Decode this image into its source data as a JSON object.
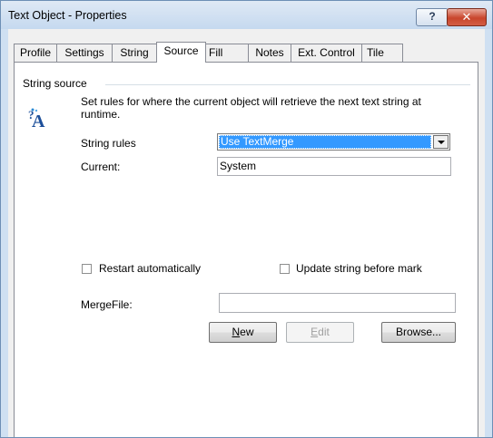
{
  "window": {
    "title": "Text Object - Properties",
    "help_label": "?",
    "close_label": "✕"
  },
  "tabs": [
    {
      "label": "Profile"
    },
    {
      "label": "Settings"
    },
    {
      "label": "String"
    },
    {
      "label": "Source",
      "active": true
    },
    {
      "label": "Fill"
    },
    {
      "label": "Notes"
    },
    {
      "label": "Ext. Control"
    },
    {
      "label": "Tile"
    }
  ],
  "source": {
    "group_label": "String source",
    "icon": "text-string-icon",
    "description": "Set rules for where the current object will retrieve the next text string at runtime.",
    "string_rules_label": "String rules",
    "string_rules_value": "Use TextMerge",
    "current_label": "Current:",
    "current_value": "System",
    "restart_label": "Restart automatically",
    "restart_checked": false,
    "update_label": "Update string before mark",
    "update_checked": false,
    "mergefile_label": "MergeFile:",
    "mergefile_value": "",
    "new_label_mnemonic": "N",
    "new_label_rest": "ew",
    "edit_label_mnemonic": "E",
    "edit_label_rest": "dit",
    "browse_label": "Browse..."
  },
  "colors": {
    "selection": "#3399ff",
    "title_gradient_top": "#dfe9f5",
    "close_red": "#c8452c"
  }
}
